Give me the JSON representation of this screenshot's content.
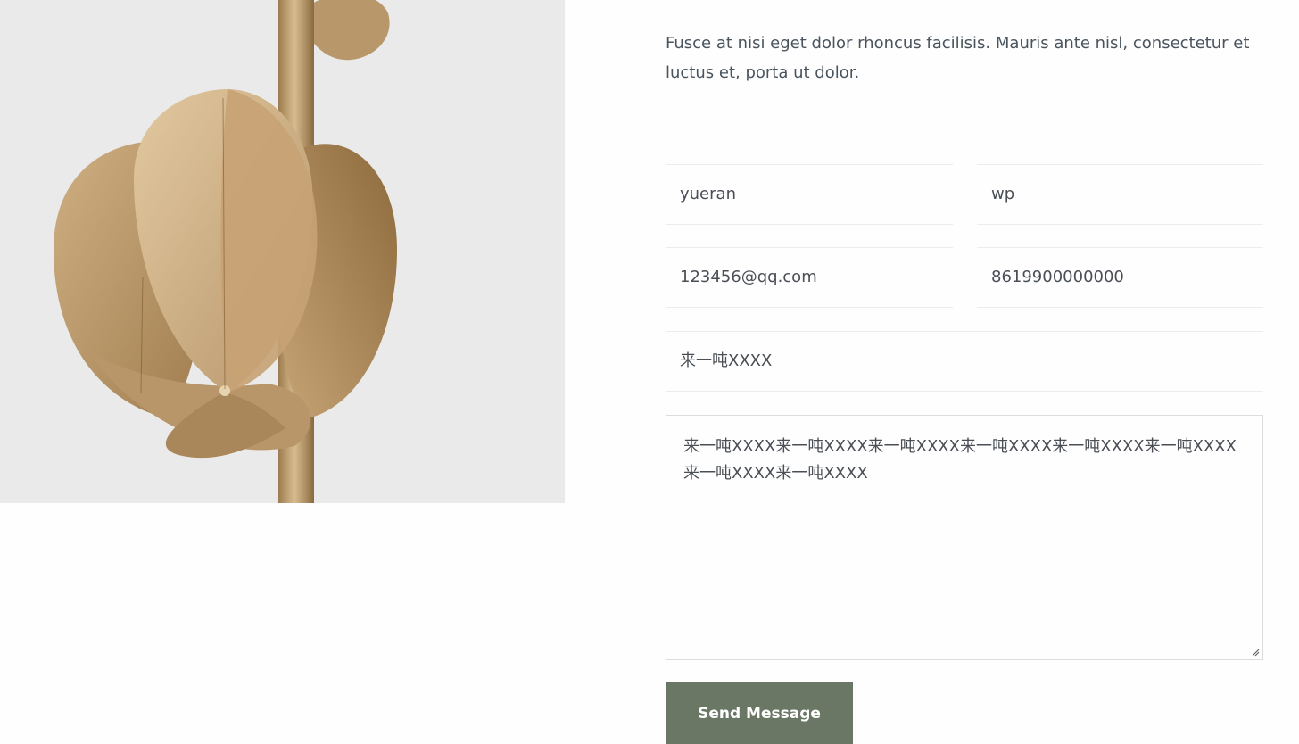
{
  "intro_text": "Fusce at nisi eget dolor rhoncus facilisis. Mauris ante nisl, consectetur et luctus et, porta ut dolor.",
  "form": {
    "first_name": {
      "value": "yueran"
    },
    "last_name": {
      "value": "wp"
    },
    "email": {
      "value": "123456@qq.com"
    },
    "phone": {
      "value": "8619900000000"
    },
    "subject": {
      "value": "来一吨XXXX"
    },
    "message": {
      "value": "来一吨XXXX来一吨XXXX来一吨XXXX来一吨XXXX来一吨XXXX来一吨XXXX来一吨XXXX来一吨XXXX"
    },
    "send_label": "Send Message"
  },
  "colors": {
    "button_bg": "#6a7764",
    "image_bg": "#ebeaea",
    "text": "#4a4f55",
    "brass": "#b9976a"
  }
}
